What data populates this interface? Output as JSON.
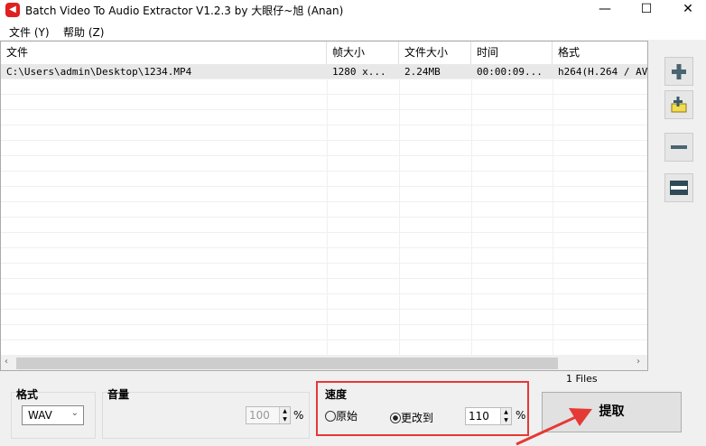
{
  "window": {
    "title": "Batch Video To Audio Extractor V1.2.3 by 大眼仔~旭 (Anan)",
    "minimize": "—",
    "maximize": "☐",
    "close": "✕"
  },
  "menu": [
    "文件 (Y)",
    "帮助 (Z)"
  ],
  "table": {
    "columns": [
      "文件",
      "帧大小",
      "文件大小",
      "时间",
      "格式"
    ],
    "rows": [
      [
        "C:\\Users\\admin\\Desktop\\1234.MP4",
        "1280 x...",
        "2.24MB",
        "00:00:09...",
        "h264(H.264 / AVC"
      ]
    ]
  },
  "side_buttons": [
    "add-file",
    "add-folder",
    "remove",
    "clear"
  ],
  "format": {
    "label": "格式",
    "value": "WAV"
  },
  "volume": {
    "label": "音量",
    "value": "100",
    "unit": "%"
  },
  "speed": {
    "label": "速度",
    "original": "原始",
    "change_to": "更改到",
    "value": "110",
    "unit": "%",
    "selected": "change_to"
  },
  "file_count": "1 Files",
  "extract_button": "提取",
  "highlight_color": "#e53935"
}
